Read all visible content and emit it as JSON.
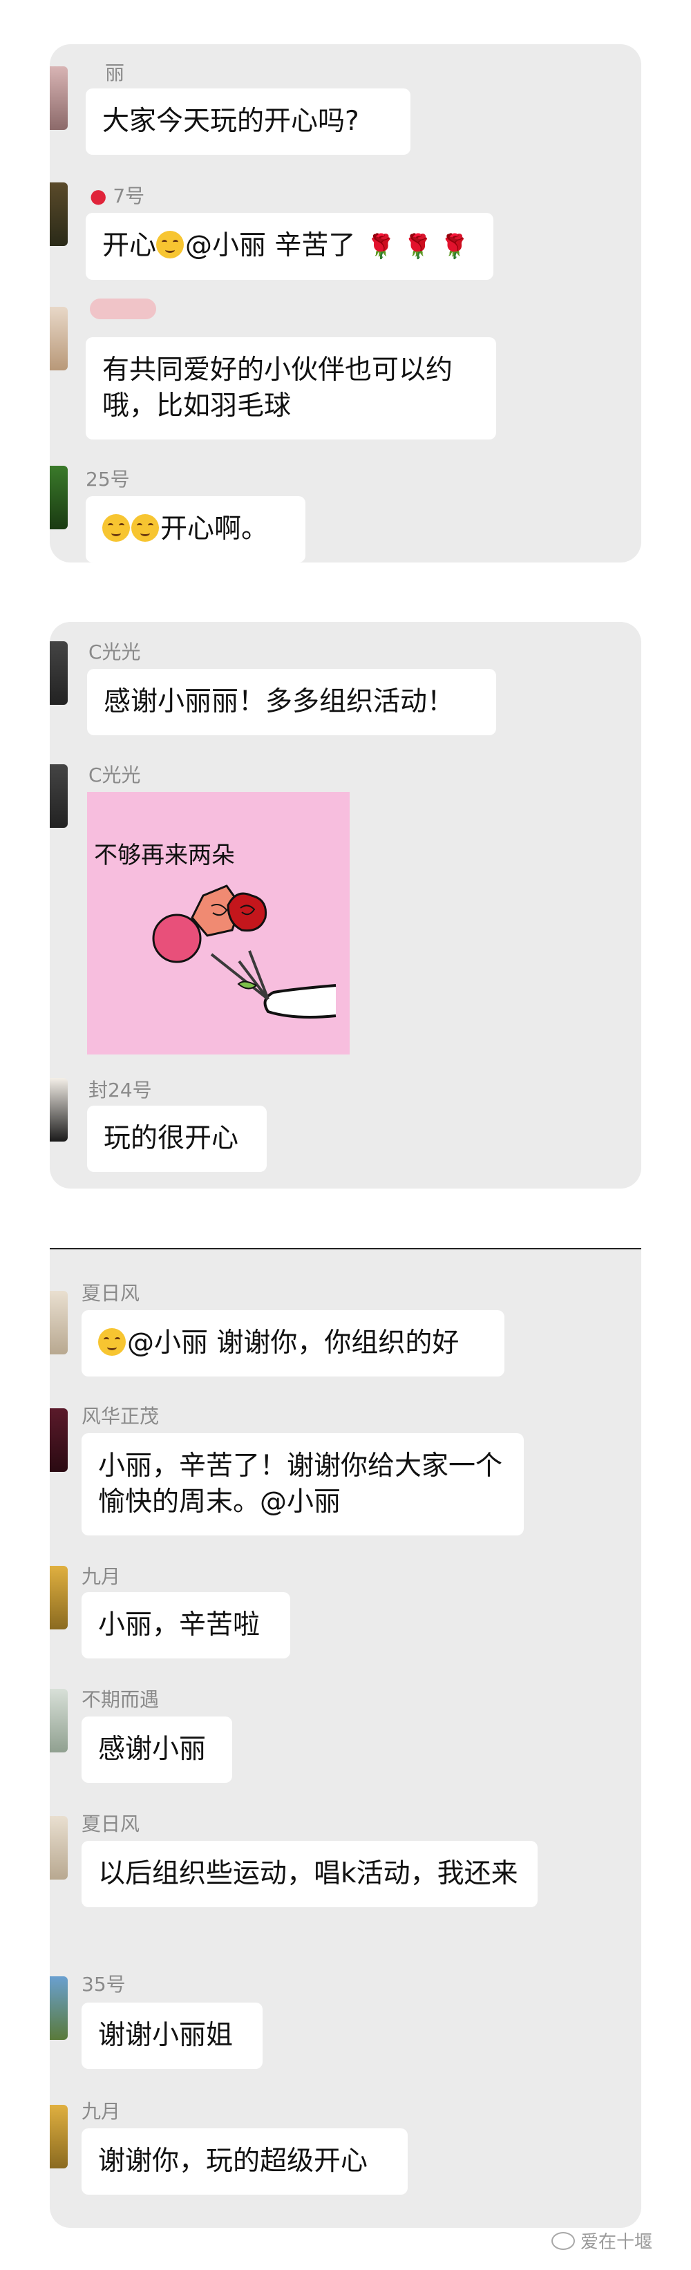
{
  "card1": {
    "messages": [
      {
        "name": "丽",
        "text": "大家今天玩的开心吗?"
      },
      {
        "name": "7号",
        "text_prefix": "开心",
        "text_suffix": "@小丽 辛苦了",
        "roses": "🌹 🌹 🌹"
      },
      {
        "name": "",
        "text": "有共同爱好的小伙伴也可以约哦，比如羽毛球"
      },
      {
        "name": "25号",
        "text": "开心啊。"
      }
    ]
  },
  "card2": {
    "messages": [
      {
        "name": "C光光",
        "text": "感谢小丽丽！多多组织活动！"
      },
      {
        "name": "C光光",
        "sticker_text": "不够再来两朵"
      },
      {
        "name": "封24号",
        "text": "玩的很开心"
      }
    ]
  },
  "card3": {
    "messages": [
      {
        "name": "夏日风",
        "text": "@小丽 谢谢你，你组织的好"
      },
      {
        "name": "风华正茂",
        "text": "小丽，辛苦了！谢谢你给大家一个愉快的周末。@小丽"
      },
      {
        "name": "九月",
        "text": "小丽，辛苦啦"
      },
      {
        "name": "不期而遇",
        "text": "感谢小丽"
      },
      {
        "name": "夏日风",
        "text": "以后组织些运动，唱k活动，我还来"
      },
      {
        "name": "35号",
        "text": "谢谢小丽姐"
      },
      {
        "name": "九月",
        "text": "谢谢你，玩的超级开心"
      }
    ]
  },
  "watermark": "爱在十堰",
  "colors": {
    "card_bg": "#ebebeb",
    "bubble_bg": "#ffffff",
    "name": "#8a8a8a",
    "sticker_bg": "#f7bede"
  }
}
